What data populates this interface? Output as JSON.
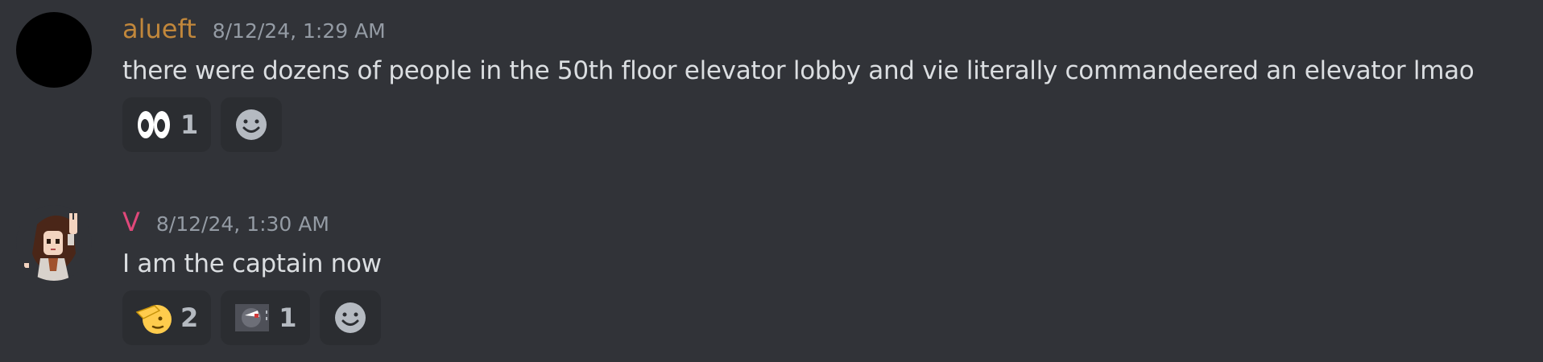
{
  "messages": [
    {
      "author": "alueft",
      "author_color": "#c1873b",
      "timestamp": "8/12/24, 1:29 AM",
      "content": "there were dozens of people in the 50th floor elevator lobby and vie literally commandeered an elevator lmao",
      "reactions": [
        {
          "emoji": "eyes-icon",
          "count": "1"
        }
      ]
    },
    {
      "author": "V",
      "author_color": "#e0487a",
      "timestamp": "8/12/24, 1:30 AM",
      "content": "I am the captain now",
      "reactions": [
        {
          "emoji": "saluting-face-icon",
          "count": "2"
        },
        {
          "emoji": "custom-emoji-icon",
          "count": "1"
        }
      ]
    }
  ]
}
